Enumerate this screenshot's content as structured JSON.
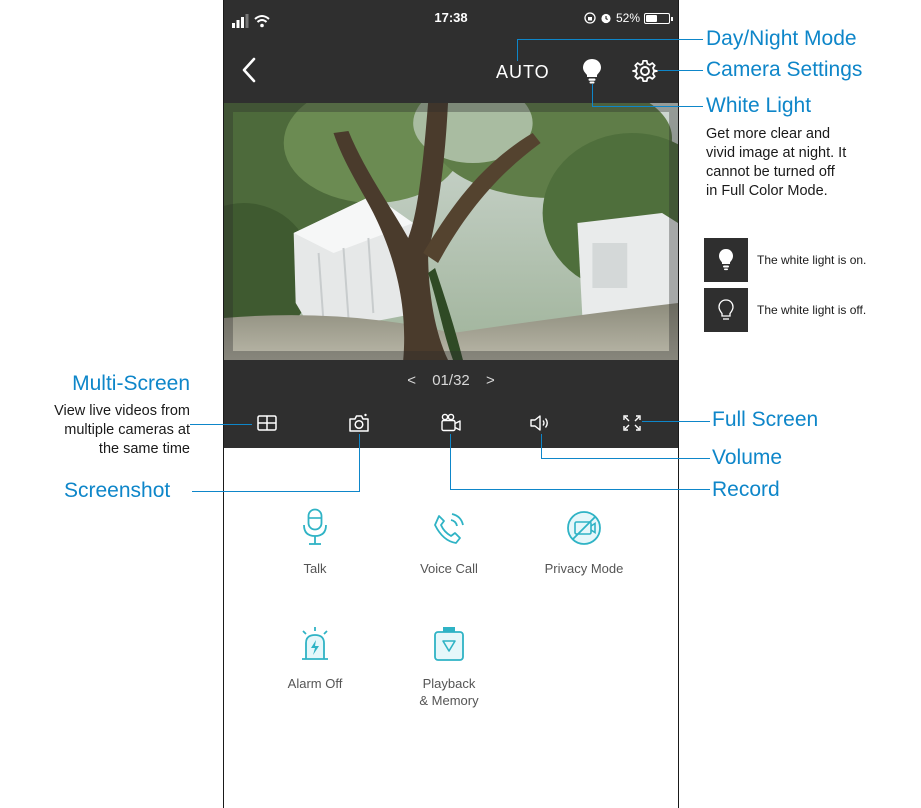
{
  "status_bar": {
    "time": "17:38",
    "battery": "52%",
    "battery_fraction": 0.52
  },
  "header": {
    "mode_label": "AUTO"
  },
  "pager": {
    "prev": "<",
    "position": "01/32",
    "next": ">"
  },
  "features": [
    {
      "label": "Talk"
    },
    {
      "label": "Voice Call"
    },
    {
      "label": "Privacy Mode"
    },
    {
      "label": "Alarm Off"
    },
    {
      "label_line1": "Playback",
      "label_line2": "& Memory"
    }
  ],
  "callouts": {
    "day_night": "Day/Night Mode",
    "camera_settings": "Camera Settings",
    "white_light": "White Light",
    "white_light_desc": [
      "Get more clear and",
      "vivid image at night. It",
      "cannot be turned off",
      "in Full Color Mode."
    ],
    "light_on": "The white light is on.",
    "light_off": "The white light is off.",
    "multi_screen": "Multi-Screen",
    "multi_screen_desc": [
      "View live videos from",
      "multiple cameras at",
      "the same time"
    ],
    "screenshot": "Screenshot",
    "full_screen": "Full Screen",
    "volume": "Volume",
    "record": "Record"
  },
  "colors": {
    "accent": "#0e86c9",
    "bar": "#2f2f2f",
    "icon_teal": "#2fb3c5"
  }
}
